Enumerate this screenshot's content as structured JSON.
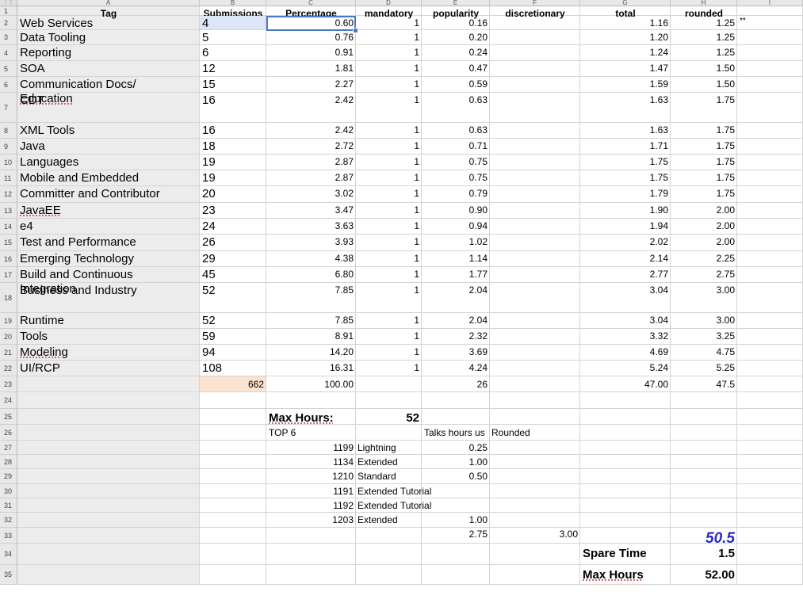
{
  "columns": [
    "A",
    "B",
    "C",
    "D",
    "E",
    "F",
    "G",
    "H",
    "I"
  ],
  "header_row": {
    "tag": "Tag",
    "submissions": "Submissions",
    "percentage": "Percentage",
    "mandatory": "mandatory",
    "popularity": "popularity",
    "discretionary": "discretionary",
    "total": "total",
    "rounded": "rounded"
  },
  "rows": [
    {
      "n": "2",
      "tag": "Web Services",
      "sub": "4",
      "pct": "0.60",
      "man": "1",
      "pop": "0.16",
      "tot": "1.16",
      "rnd": "1.25",
      "note": "**"
    },
    {
      "n": "3",
      "tag": "Data Tooling",
      "sub": "5",
      "pct": "0.76",
      "man": "1",
      "pop": "0.20",
      "tot": "1.20",
      "rnd": "1.25"
    },
    {
      "n": "4",
      "tag": "Reporting",
      "sub": "6",
      "pct": "0.91",
      "man": "1",
      "pop": "0.24",
      "tot": "1.24",
      "rnd": "1.25"
    },
    {
      "n": "5",
      "tag": "SOA",
      "sub": "12",
      "pct": "1.81",
      "man": "1",
      "pop": "0.47",
      "tot": "1.47",
      "rnd": "1.50"
    },
    {
      "n": "6",
      "tag": "Communication Docs/",
      "tag2": "Education",
      "sub": "15",
      "pct": "2.27",
      "man": "1",
      "pop": "0.59",
      "tot": "1.59",
      "rnd": "1.50"
    },
    {
      "n": "7",
      "tag": "CDT",
      "sub": "16",
      "pct": "2.42",
      "man": "1",
      "pop": "0.63",
      "tot": "1.63",
      "rnd": "1.75"
    },
    {
      "n": "8",
      "tag": "XML Tools",
      "sub": "16",
      "pct": "2.42",
      "man": "1",
      "pop": "0.63",
      "tot": "1.63",
      "rnd": "1.75"
    },
    {
      "n": "9",
      "tag": "Java",
      "sub": "18",
      "pct": "2.72",
      "man": "1",
      "pop": "0.71",
      "tot": "1.71",
      "rnd": "1.75"
    },
    {
      "n": "10",
      "tag": "Languages",
      "sub": "19",
      "pct": "2.87",
      "man": "1",
      "pop": "0.75",
      "tot": "1.75",
      "rnd": "1.75"
    },
    {
      "n": "11",
      "tag": "Mobile and Embedded",
      "sub": "19",
      "pct": "2.87",
      "man": "1",
      "pop": "0.75",
      "tot": "1.75",
      "rnd": "1.75"
    },
    {
      "n": "12",
      "tag": "Committer and Contributor",
      "sub": "20",
      "pct": "3.02",
      "man": "1",
      "pop": "0.79",
      "tot": "1.79",
      "rnd": "1.75"
    },
    {
      "n": "13",
      "tag": "JavaEE",
      "sub": "23",
      "pct": "3.47",
      "man": "1",
      "pop": "0.90",
      "tot": "1.90",
      "rnd": "2.00"
    },
    {
      "n": "14",
      "tag": "e4",
      "sub": "24",
      "pct": "3.63",
      "man": "1",
      "pop": "0.94",
      "tot": "1.94",
      "rnd": "2.00"
    },
    {
      "n": "15",
      "tag": "Test and Performance",
      "sub": "26",
      "pct": "3.93",
      "man": "1",
      "pop": "1.02",
      "tot": "2.02",
      "rnd": "2.00"
    },
    {
      "n": "16",
      "tag": "Emerging Technology",
      "sub": "29",
      "pct": "4.38",
      "man": "1",
      "pop": "1.14",
      "tot": "2.14",
      "rnd": "2.25"
    },
    {
      "n": "17",
      "tag": "Build and Continuous",
      "tag2": "Integration",
      "sub": "45",
      "pct": "6.80",
      "man": "1",
      "pop": "1.77",
      "tot": "2.77",
      "rnd": "2.75"
    },
    {
      "n": "18",
      "tag": "Business and Industry",
      "sub": "52",
      "pct": "7.85",
      "man": "1",
      "pop": "2.04",
      "tot": "3.04",
      "rnd": "3.00"
    },
    {
      "n": "19",
      "tag": "Runtime",
      "sub": "52",
      "pct": "7.85",
      "man": "1",
      "pop": "2.04",
      "tot": "3.04",
      "rnd": "3.00"
    },
    {
      "n": "20",
      "tag": "Tools",
      "sub": "59",
      "pct": "8.91",
      "man": "1",
      "pop": "2.32",
      "tot": "3.32",
      "rnd": "3.25"
    },
    {
      "n": "21",
      "tag": "Modeling",
      "sub": "94",
      "pct": "14.20",
      "man": "1",
      "pop": "3.69",
      "tot": "4.69",
      "rnd": "4.75"
    },
    {
      "n": "22",
      "tag": "UI/RCP",
      "sub": "108",
      "pct": "16.31",
      "man": "1",
      "pop": "4.24",
      "tot": "5.24",
      "rnd": "5.25"
    }
  ],
  "totals_row": {
    "n": "23",
    "sub": "662",
    "pct": "100.00",
    "pop": "26",
    "tot": "47.00",
    "rnd": "47.5"
  },
  "extra_rownums": [
    "24",
    "25",
    "26",
    "27",
    "28",
    "29",
    "30",
    "31",
    "32",
    "33",
    "34",
    "35"
  ],
  "lower": {
    "max_hours_label": "Max Hours:",
    "max_hours_value": "52",
    "top6": "TOP 6",
    "talks_hours": "Talks hours us",
    "rounded": "Rounded",
    "talks": [
      {
        "id": "1199",
        "kind": "Lightning",
        "hours": "0.25"
      },
      {
        "id": "1134",
        "kind": "Extended",
        "hours": "1.00"
      },
      {
        "id": "1210",
        "kind": "Standard",
        "hours": "0.50"
      },
      {
        "id": "1191",
        "kind": "Extended Tutorial",
        "hours": ""
      },
      {
        "id": "1192",
        "kind": "Extended Tutorial",
        "hours": ""
      },
      {
        "id": "1203",
        "kind": "Extended",
        "hours": "1.00"
      }
    ],
    "sum_e": "2.75",
    "sum_f": "3.00",
    "grand": "50.5",
    "spare_label": "Spare Time",
    "spare_value": "1.5",
    "max_label": "Max Hours",
    "max_value": "52.00"
  },
  "colors": {
    "selection": "#4a78c8",
    "grand_total": "#2a2ad0",
    "peach": "#fce3cf",
    "highlight": "#dce6f8"
  }
}
